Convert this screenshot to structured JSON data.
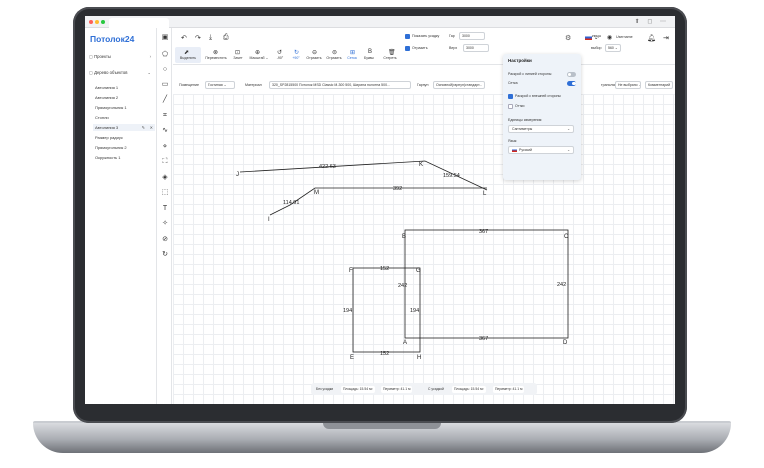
{
  "app": {
    "logo": "Потолок24"
  },
  "sidebar": {
    "sections": [
      {
        "label": "Проекты"
      },
      {
        "label": "Дерево объектов"
      }
    ],
    "items": [
      {
        "label": "Автолиния 1"
      },
      {
        "label": "Автолиния 2"
      },
      {
        "label": "Прямоугольник 1"
      },
      {
        "label": "Стопли"
      },
      {
        "label": "Автолиния 3"
      },
      {
        "label": "Размер радиус"
      },
      {
        "label": "Прямоугольник 2"
      },
      {
        "label": "Окружность 1"
      }
    ]
  },
  "toolbar": {
    "buttons": [
      {
        "label": "Выделить"
      },
      {
        "label": "Переместить"
      },
      {
        "label": "Зачет"
      },
      {
        "label": "Масштаб"
      },
      {
        "label": "-90°"
      },
      {
        "label": "+90°"
      },
      {
        "label": "Отразить"
      },
      {
        "label": "Отразить"
      },
      {
        "label": "Сетка"
      },
      {
        "label": "Буквы"
      },
      {
        "label": "Стереть"
      }
    ],
    "show_corner_label": "Показать усадку",
    "gap_label": "Гар",
    "gap_value": "3000",
    "reflect_label": "Отразить",
    "height_label": "Верх",
    "height_value": "3000",
    "page_label": "страницы",
    "choose_label": "выбор",
    "choose_value": "560",
    "user_name": "Username"
  },
  "props": {
    "room_label": "Помещение",
    "room_value": "Гостиная",
    "material_label": "Материал",
    "material_value": "320_SP2815500 Потолок MSD Classic M-300 500, Ширина полотна 500...",
    "fixture_label": "Гарпун",
    "fixture_value": "Основной(гарпун)стандарт...",
    "extra_label": "трансляция",
    "extra_value": "Не выбрано",
    "comment_label": "Комментарий"
  },
  "settings": {
    "title": "Настройки",
    "rows": [
      {
        "label": "Раскрой с линией стороны",
        "on": false
      },
      {
        "label": "Сетка",
        "on": true
      }
    ],
    "check_label": "Раскрой с внешней стороны",
    "check2_label": "Оттки",
    "units_label": "Единицы измерения:",
    "units_value": "Сантиметры",
    "lang_label": "Язык:",
    "lang_value": "Русский"
  },
  "status": {
    "items": [
      {
        "label": "Без усадки"
      },
      {
        "label": "Площадь: 15.54 м²"
      },
      {
        "label": "Периметр: 41.1 м"
      },
      {
        "label": "С усадкой"
      },
      {
        "label": "Площадь: 15.54 м²"
      },
      {
        "label": "Периметр: 41.1 м"
      }
    ]
  },
  "drawing": {
    "points": [
      "J",
      "K",
      "L",
      "M",
      "I",
      "B",
      "C",
      "D",
      "A",
      "F",
      "G",
      "E",
      "H"
    ],
    "dimensions": [
      "422.63",
      "159.54",
      "392",
      "114.91",
      "367",
      "242",
      "367",
      "152",
      "242",
      "194",
      "194",
      "152"
    ]
  },
  "colors": {
    "accent": "#2f6fd6",
    "active_bg": "#e9eef7"
  }
}
